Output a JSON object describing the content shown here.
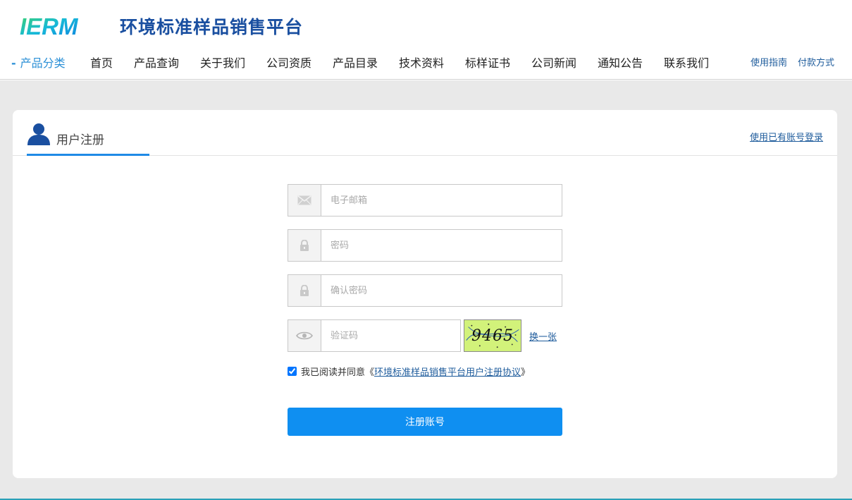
{
  "header": {
    "logo_mark": "IERM",
    "site_title": "环境标准样品销售平台"
  },
  "nav": {
    "category": "产品分类",
    "items": [
      "首页",
      "产品查询",
      "关于我们",
      "公司资质",
      "产品目录",
      "技术资料",
      "标样证书",
      "公司新闻",
      "通知公告",
      "联系我们"
    ],
    "utility": [
      "使用指南",
      "付款方式"
    ]
  },
  "card": {
    "tab_label": "用户注册",
    "login_link": "使用已有账号登录"
  },
  "form": {
    "email_placeholder": "电子邮箱",
    "password_placeholder": "密码",
    "confirm_placeholder": "确认密码",
    "captcha_placeholder": "验证码",
    "captcha_text": "9465",
    "refresh_label": "换一张",
    "agree_prefix": "我已阅读并同意《",
    "agreement_title": "环境标准样品销售平台用户注册协议",
    "agree_suffix": "》",
    "agree_checked": true,
    "submit_label": "注册账号"
  },
  "colors": {
    "accent": "#0f8ff1",
    "link": "#1f5c9c",
    "tab_underline": "#1f8ae6",
    "background": "#e9e9e9"
  },
  "icons": {
    "email": "envelope-icon",
    "password": "lock-icon",
    "confirm": "lock-icon",
    "captcha": "eye-icon",
    "user": "user-icon"
  }
}
